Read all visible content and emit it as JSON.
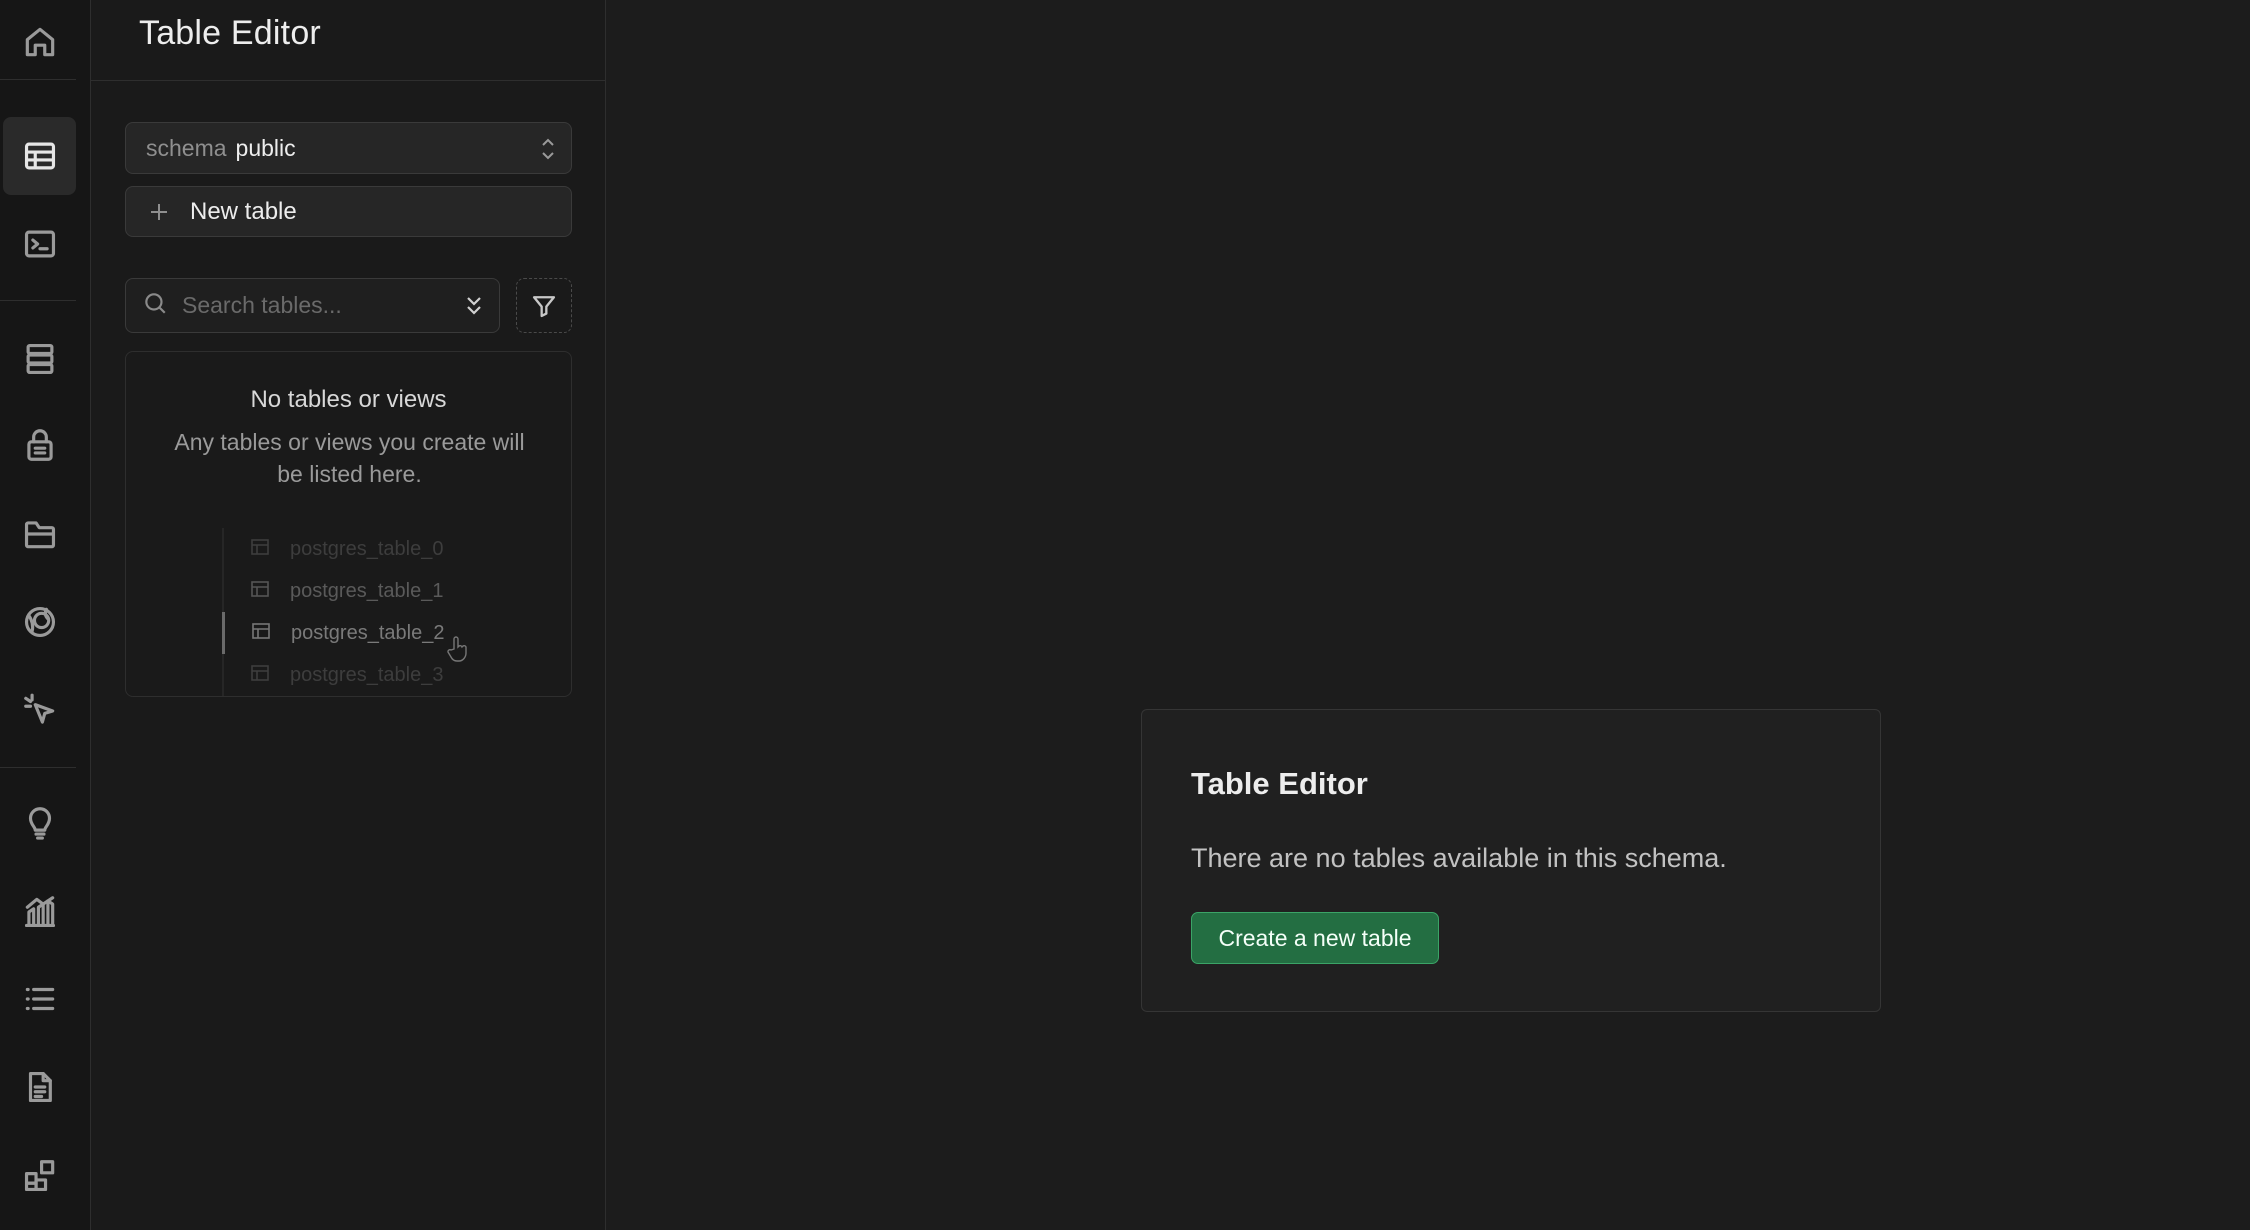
{
  "rail": {
    "items": [
      {
        "name": "home-icon"
      },
      {
        "name": "table-editor-icon",
        "active": true
      },
      {
        "name": "sql-editor-icon"
      },
      {
        "name": "database-icon"
      },
      {
        "name": "authentication-icon"
      },
      {
        "name": "storage-icon"
      },
      {
        "name": "realtime-icon"
      },
      {
        "name": "edge-functions-icon"
      },
      {
        "name": "advisors-icon"
      },
      {
        "name": "reports-icon"
      },
      {
        "name": "logs-icon"
      },
      {
        "name": "api-docs-icon"
      },
      {
        "name": "integrations-icon"
      }
    ]
  },
  "sidebar": {
    "title": "Table Editor",
    "schema": {
      "label": "schema",
      "value": "public"
    },
    "new_table_label": "New table",
    "search": {
      "placeholder": "Search tables..."
    },
    "empty": {
      "title": "No tables or views",
      "description": "Any tables or views you create will be listed here."
    },
    "ghost_tables": [
      "postgres_table_0",
      "postgres_table_1",
      "postgres_table_2",
      "postgres_table_3"
    ]
  },
  "main": {
    "card": {
      "title": "Table Editor",
      "message": "There are no tables available in this schema.",
      "button_label": "Create a new table"
    }
  },
  "colors": {
    "background": "#1c1c1c",
    "sidebar": "#1a1a1a",
    "brand_button": "#236e42",
    "brand_border": "#3ba467"
  }
}
